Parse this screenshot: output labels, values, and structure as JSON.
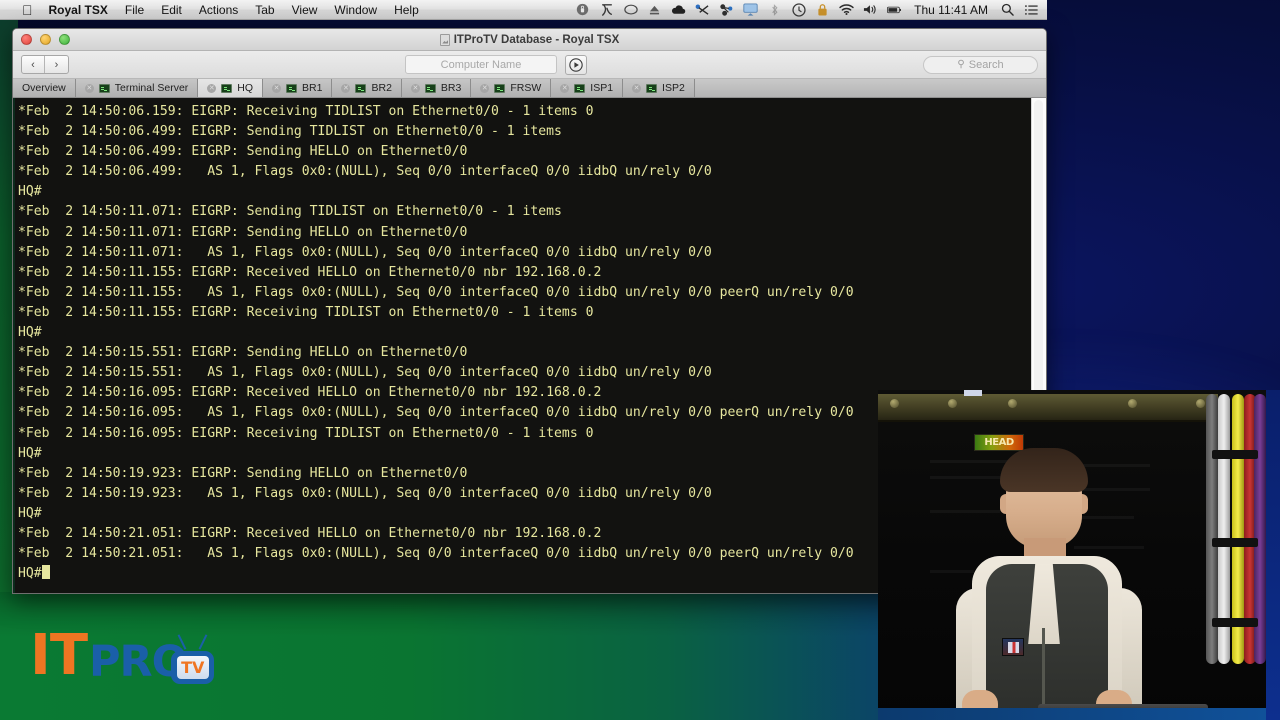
{
  "desktop": {
    "wallpaper_color": "#060d3a",
    "accent_green": "#0a7531"
  },
  "menubar": {
    "apple_icon": "apple-logo",
    "items": [
      {
        "label": "Royal TSX",
        "bold": true
      },
      {
        "label": "File",
        "bold": false
      },
      {
        "label": "Edit",
        "bold": false
      },
      {
        "label": "Actions",
        "bold": false
      },
      {
        "label": "Tab",
        "bold": false
      },
      {
        "label": "View",
        "bold": false
      },
      {
        "label": "Window",
        "bold": false
      },
      {
        "label": "Help",
        "bold": false
      }
    ],
    "status_icons": [
      "privacy-lock-icon",
      "text-input-source-icon",
      "speech-bubble-icon",
      "eject-icon",
      "cloud-icon",
      "scissors-icon",
      "network-share-icon",
      "airplay-icon",
      "bluetooth-icon",
      "time-machine-icon",
      "keychain-lock-icon",
      "wifi-icon",
      "volume-icon",
      "battery-icon"
    ],
    "clock": "Thu 11:41 AM",
    "spotlight_icon": "search-icon",
    "notification_center_icon": "list-icon"
  },
  "window": {
    "title": "ITProTV Database - Royal TSX",
    "title_icon": "document-icon",
    "traffic_lights": [
      "close",
      "minimize",
      "zoom"
    ],
    "toolbar": {
      "back_icon": "chevron-left-icon",
      "forward_icon": "chevron-right-icon",
      "computer_name_placeholder": "Computer Name",
      "computer_name_value": "",
      "connect_icon": "play-circle-icon",
      "search_placeholder": "Search",
      "search_value": "",
      "search_icon": "search-icon"
    },
    "tabs": [
      {
        "label": "Overview",
        "closable": false,
        "icon": null,
        "active": false
      },
      {
        "label": "Terminal Server",
        "closable": true,
        "icon": "terminal-icon",
        "active": false
      },
      {
        "label": "HQ",
        "closable": true,
        "icon": "terminal-icon",
        "active": true
      },
      {
        "label": "BR1",
        "closable": true,
        "icon": "terminal-icon",
        "active": false
      },
      {
        "label": "BR2",
        "closable": true,
        "icon": "terminal-icon",
        "active": false
      },
      {
        "label": "BR3",
        "closable": true,
        "icon": "terminal-icon",
        "active": false
      },
      {
        "label": "FRSW",
        "closable": true,
        "icon": "terminal-icon",
        "active": false
      },
      {
        "label": "ISP1",
        "closable": true,
        "icon": "terminal-icon",
        "active": false
      },
      {
        "label": "ISP2",
        "closable": true,
        "icon": "terminal-icon",
        "active": false
      }
    ],
    "terminal": {
      "foreground_color": "#e6e69e",
      "background_color": "#121210",
      "cursor": "block",
      "prompt": "HQ#",
      "lines": [
        "*Feb  2 14:50:06.159: EIGRP: Receiving TIDLIST on Ethernet0/0 - 1 items 0",
        "*Feb  2 14:50:06.499: EIGRP: Sending TIDLIST on Ethernet0/0 - 1 items",
        "*Feb  2 14:50:06.499: EIGRP: Sending HELLO on Ethernet0/0",
        "*Feb  2 14:50:06.499:   AS 1, Flags 0x0:(NULL), Seq 0/0 interfaceQ 0/0 iidbQ un/rely 0/0",
        "HQ#",
        "*Feb  2 14:50:11.071: EIGRP: Sending TIDLIST on Ethernet0/0 - 1 items",
        "*Feb  2 14:50:11.071: EIGRP: Sending HELLO on Ethernet0/0",
        "*Feb  2 14:50:11.071:   AS 1, Flags 0x0:(NULL), Seq 0/0 interfaceQ 0/0 iidbQ un/rely 0/0",
        "*Feb  2 14:50:11.155: EIGRP: Received HELLO on Ethernet0/0 nbr 192.168.0.2",
        "*Feb  2 14:50:11.155:   AS 1, Flags 0x0:(NULL), Seq 0/0 interfaceQ 0/0 iidbQ un/rely 0/0 peerQ un/rely 0/0",
        "*Feb  2 14:50:11.155: EIGRP: Receiving TIDLIST on Ethernet0/0 - 1 items 0",
        "HQ#",
        "*Feb  2 14:50:15.551: EIGRP: Sending HELLO on Ethernet0/0",
        "*Feb  2 14:50:15.551:   AS 1, Flags 0x0:(NULL), Seq 0/0 interfaceQ 0/0 iidbQ un/rely 0/0",
        "*Feb  2 14:50:16.095: EIGRP: Received HELLO on Ethernet0/0 nbr 192.168.0.2",
        "*Feb  2 14:50:16.095:   AS 1, Flags 0x0:(NULL), Seq 0/0 interfaceQ 0/0 iidbQ un/rely 0/0 peerQ un/rely 0/0",
        "*Feb  2 14:50:16.095: EIGRP: Receiving TIDLIST on Ethernet0/0 - 1 items 0",
        "HQ#",
        "*Feb  2 14:50:19.923: EIGRP: Sending HELLO on Ethernet0/0",
        "*Feb  2 14:50:19.923:   AS 1, Flags 0x0:(NULL), Seq 0/0 interfaceQ 0/0 iidbQ un/rely 0/0",
        "HQ#",
        "*Feb  2 14:50:21.051: EIGRP: Received HELLO on Ethernet0/0 nbr 192.168.0.2",
        "*Feb  2 14:50:21.051:   AS 1, Flags 0x0:(NULL), Seq 0/0 interfaceQ 0/0 iidbQ un/rely 0/0 peerQ un/rely 0/0"
      ],
      "last_line": "HQ#"
    }
  },
  "logo": {
    "part_it": "IT",
    "part_pro": "PRO",
    "part_tv": "TV",
    "color_it": "#ef7522",
    "color_pro": "#1a5fa8"
  },
  "video_overlay": {
    "description": "presenter-video",
    "sign_text": "HEAD",
    "subject": "instructor in dark vest and light shirt in front of network rack"
  }
}
